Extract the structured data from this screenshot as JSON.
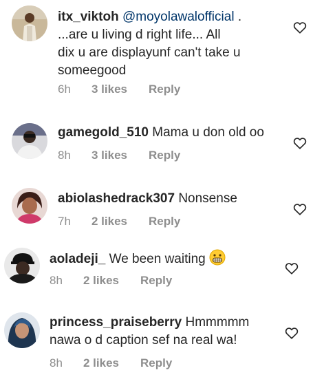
{
  "comments": [
    {
      "username": "itx_viktoh",
      "mention": "@moyolawalofficial",
      "text": " .\n...are u living d right life... All\ndix u are displayunf can't take u\nsomeegood",
      "time": "6h",
      "likes": "3 likes",
      "reply": "Reply"
    },
    {
      "username": "gamegold_510",
      "text": " Mama u don old oo",
      "time": "8h",
      "likes": "3 likes",
      "reply": "Reply"
    },
    {
      "username": "abiolashedrack307",
      "text": " Nonsense",
      "time": "7h",
      "likes": "2 likes",
      "reply": "Reply"
    },
    {
      "username": "aoladeji_",
      "text": " We been waiting ",
      "emoji": "grimacing-face-emoji",
      "time": "8h",
      "likes": "2 likes",
      "reply": "Reply"
    },
    {
      "username": "princess_praiseberry",
      "text": " Hmmmmm\nnawa o d caption sef na real wa!",
      "time": "8h",
      "likes": "2 likes",
      "reply": "Reply"
    }
  ],
  "icons": {
    "like": "heart-outline-icon"
  },
  "colors": {
    "text": "#262626",
    "meta": "#8e8e8e",
    "mention": "#003569"
  }
}
